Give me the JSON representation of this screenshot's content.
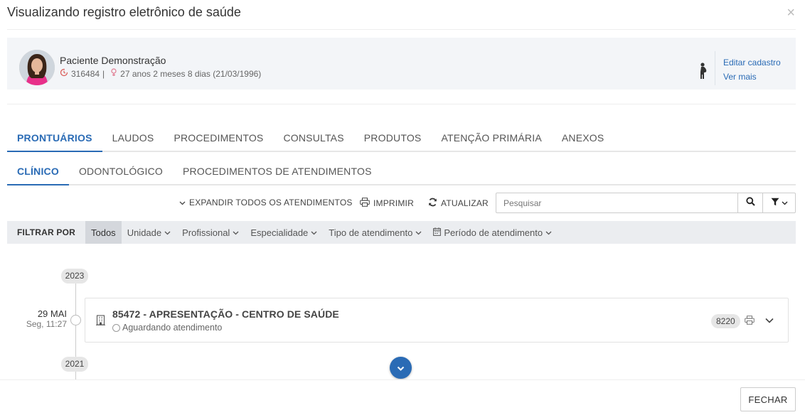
{
  "modal": {
    "title": "Visualizando registro eletrônico de saúde",
    "close_icon": "×"
  },
  "patient": {
    "name": "Paciente Demonstração",
    "record_id": "316484",
    "separator": "|",
    "age_text": "27 anos 2 meses 8 dias (21/03/1996)",
    "edit_link": "Editar cadastro",
    "more_link": "Ver mais",
    "icons": {
      "id": "history-icon",
      "sex": "female-icon",
      "status": "pregnant-icon"
    }
  },
  "main_tabs": [
    {
      "label": "PRONTUÁRIOS",
      "active": true
    },
    {
      "label": "LAUDOS",
      "active": false
    },
    {
      "label": "PROCEDIMENTOS",
      "active": false
    },
    {
      "label": "CONSULTAS",
      "active": false
    },
    {
      "label": "PRODUTOS",
      "active": false
    },
    {
      "label": "ATENÇÃO PRIMÁRIA",
      "active": false
    },
    {
      "label": "ANEXOS",
      "active": false
    }
  ],
  "sub_tabs": [
    {
      "label": "CLÍNICO",
      "active": true
    },
    {
      "label": "ODONTOLÓGICO",
      "active": false
    },
    {
      "label": "PROCEDIMENTOS DE ATENDIMENTOS",
      "active": false
    }
  ],
  "toolbar": {
    "expand_all": "EXPANDIR TODOS OS ATENDIMENTOS",
    "print": "IMPRIMIR",
    "refresh": "ATUALIZAR",
    "search_placeholder": "Pesquisar"
  },
  "filters": {
    "label": "FILTRAR POR",
    "items": [
      {
        "label": "Todos",
        "active": true,
        "dropdown": false
      },
      {
        "label": "Unidade",
        "active": false,
        "dropdown": true
      },
      {
        "label": "Profissional",
        "active": false,
        "dropdown": true
      },
      {
        "label": "Especialidade",
        "active": false,
        "dropdown": true
      },
      {
        "label": "Tipo de atendimento",
        "active": false,
        "dropdown": true
      },
      {
        "label": "Período de atendimento",
        "active": false,
        "dropdown": true,
        "icon": "calendar-icon"
      }
    ]
  },
  "timeline": {
    "years": [
      "2023",
      "2021"
    ],
    "entries": [
      {
        "day": "29 MAI",
        "time": "Seg, 11:27",
        "title": "85472 - APRESENTAÇÃO - CENTRO DE SAÚDE",
        "status": "Aguardando atendimento",
        "badge": "8220"
      }
    ]
  },
  "footer": {
    "close_button": "FECHAR"
  },
  "colors": {
    "accent": "#2a6bb5",
    "card_bg": "#f3f5f8",
    "filter_bar_bg": "#ebedf0"
  }
}
